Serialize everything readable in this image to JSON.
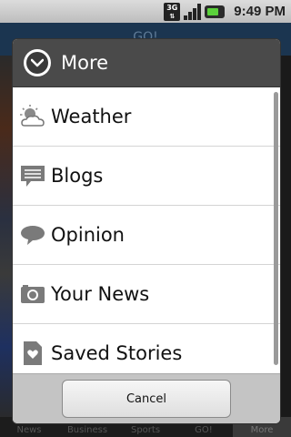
{
  "status_bar": {
    "network": "3G",
    "time": "9:49 PM"
  },
  "background_app": {
    "header_text": "GO!",
    "tabs": [
      "News",
      "Business",
      "Sports",
      "GO!",
      "More"
    ],
    "active_tab": "More"
  },
  "dialog": {
    "title": "More",
    "items": [
      {
        "label": "Weather",
        "icon": "weather-icon"
      },
      {
        "label": "Blogs",
        "icon": "blogs-icon"
      },
      {
        "label": "Opinion",
        "icon": "opinion-icon"
      },
      {
        "label": "Your News",
        "icon": "camera-icon"
      },
      {
        "label": "Saved Stories",
        "icon": "saved-stories-icon"
      }
    ],
    "cancel_label": "Cancel"
  }
}
